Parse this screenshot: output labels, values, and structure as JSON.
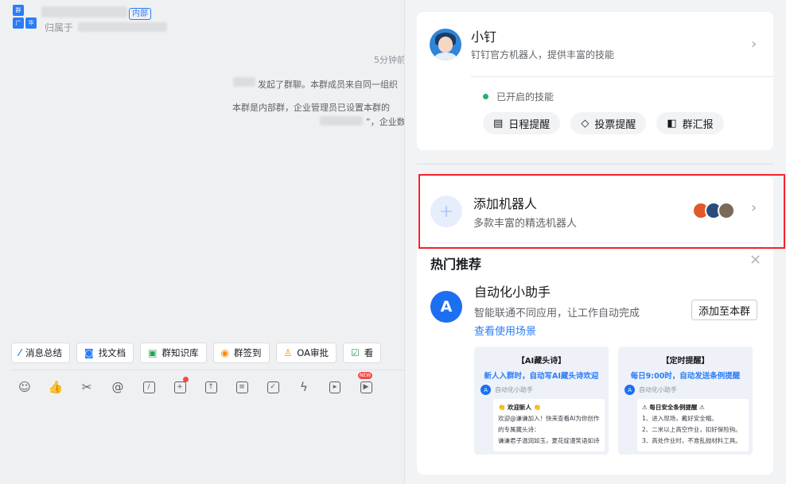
{
  "chat": {
    "tag_internal": "内部",
    "belong_label": "归属于",
    "time_label": "5分钟前",
    "sys_msg_1": "发起了群聊。本群成员来自同一组织",
    "sys_msg_2": "本群是内部群，企业管理员已设置本群的",
    "sys_msg_3": "”，企业数",
    "group_avatar_chars": [
      "群",
      "广",
      "华"
    ],
    "quick_tools": [
      {
        "icon": "sparkle-icon",
        "glyph": "⁄",
        "label": "消息总结"
      },
      {
        "icon": "search-doc-icon",
        "glyph": "◙",
        "label": "找文档"
      },
      {
        "icon": "knowledge-base-icon",
        "glyph": "▣",
        "label": "群知识库"
      },
      {
        "icon": "location-icon",
        "glyph": "◉",
        "label": "群签到"
      },
      {
        "icon": "approval-icon",
        "glyph": "♙",
        "label": "OA审批"
      },
      {
        "icon": "checkbox-icon",
        "glyph": "☑",
        "label": "看"
      }
    ],
    "new_badge": "NEW"
  },
  "panel": {
    "robot": {
      "name": "小钉",
      "desc": "钉钉官方机器人，提供丰富的技能",
      "skills_label": "已开启的技能",
      "skills": [
        {
          "icon": "calendar-icon",
          "glyph": "▤",
          "label": "日程提醒"
        },
        {
          "icon": "vote-icon",
          "glyph": "◇",
          "label": "投票提醒"
        },
        {
          "icon": "report-icon",
          "glyph": "◧",
          "label": "群汇报"
        }
      ]
    },
    "add_robot": {
      "title": "添加机器人",
      "desc": "多款丰富的精选机器人"
    },
    "hot": {
      "title": "热门推荐",
      "app_name": "自动化小助手",
      "app_desc": "智能联通不同应用，让工作自动完成",
      "usage_link": "查看使用场景",
      "add_button": "添加至本群",
      "icon_letter": "A"
    },
    "previews": [
      {
        "head": "【AI藏头诗】",
        "sub": "新人入群时，自动写AI藏头诗欢迎",
        "sender": "自动化小助手",
        "lines": [
          "👏 欢迎新人 👏",
          "欢迎@谦谦加入！快来查看AI为你创作",
          "的专属藏头诗：",
          "谦谦君子温润如玉，夏花绽漫笑语如诗"
        ]
      },
      {
        "head": "【定时提醒】",
        "sub": "每日9:00时，自动发送条例提醒",
        "sender": "自动化小助手",
        "lines": [
          "⚠ 每日安全条例提醒 ⚠",
          "1、进入现场，戴好安全帽。",
          "2、二米以上高空作业，扣好保险钩。",
          "3、高处作业时，不准乱抛材料工具。"
        ]
      }
    ]
  }
}
